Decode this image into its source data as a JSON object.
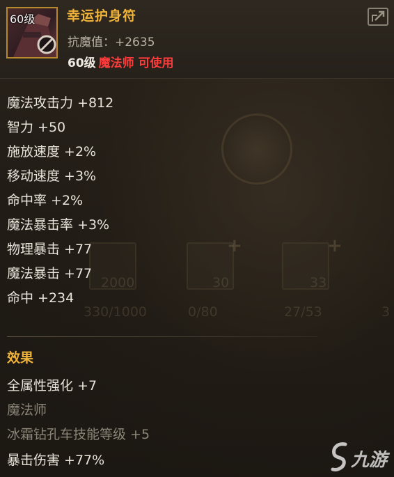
{
  "item": {
    "icon_level": "60级",
    "name": "幸运护身符",
    "anti_magic_label": "抗魔值：+2635",
    "req_level": "60级",
    "req_class": "魔法师 可使用",
    "icon_name": "amulet-icon"
  },
  "stats": [
    "魔法攻击力 +812",
    "智力 +50",
    "施放速度 +2%",
    "移动速度 +3%",
    "命中率 +2%",
    "魔法暴击率 +3%",
    "物理暴击 +77",
    "魔法暴击 +77",
    "命中 +234"
  ],
  "effect": {
    "title": "效果",
    "lines": [
      "全属性强化 +7",
      "魔法师",
      "冰霜钻孔车技能等级 +5",
      "暴击伤害 +77%"
    ]
  },
  "background_ui": {
    "counts": [
      "330/1000",
      "0/80",
      "27/53",
      "3"
    ],
    "slot_nums": [
      "2000",
      "30",
      "33"
    ]
  },
  "watermark": "九游",
  "colors": {
    "item_name": "#f0b43a",
    "class_requirement": "#ff3b3b",
    "stat_text": "#e9e4da",
    "dim_text": "#8c8679",
    "icon_border": "#b7892f"
  }
}
